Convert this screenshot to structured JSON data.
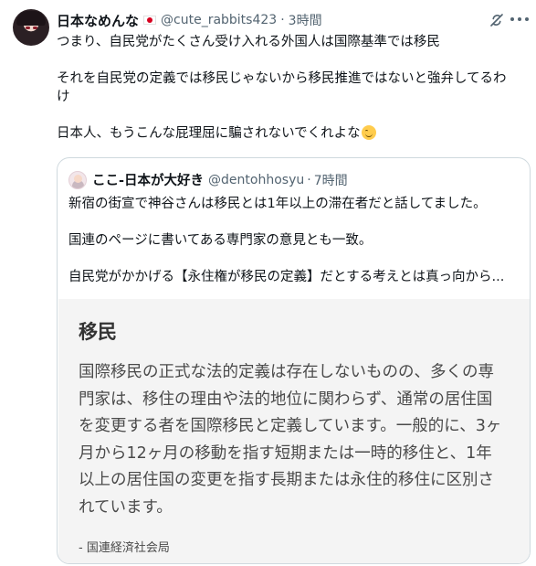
{
  "post": {
    "author_name": "日本なめんな",
    "handle": "@cute_rabbits423",
    "separator": "·",
    "time": "3時間",
    "lines": [
      "つまり、自民党がたくさん受け入れる外国人は国際基準では移民",
      "",
      "それを自民党の定義では移民じゃないから移民推進ではないと強弁してるわ",
      "け",
      "",
      "日本人、もうこんな屁理屈に騙されないでくれよな"
    ],
    "flag_icon": "japan-flag-icon",
    "end_emoji_icon": "winking-face-icon"
  },
  "quote": {
    "author_name": "ここ-日本が大好き",
    "handle": "@dentohhosyu",
    "separator": "·",
    "time": "7時間",
    "lines": [
      "新宿の街宣で神谷さんは移民とは1年以上の滞在者だと話してました。",
      "",
      "国連のページに書いてある専門家の意見とも一致。",
      "",
      "自民党がかかげる【永住権が移民の定義】だとする考えとは真っ向から..."
    ],
    "image": {
      "title": "移民",
      "body_lines": [
        "国際移民の正式な法的定義は存在しないものの、多くの専",
        "門家は、移住の理由や法的地位に関わらず、通常の居住国",
        "を変更する者を国際移民と定義しています。一般的に、3ヶ",
        "月から12ヶ月の移動を指す短期または一時的移住と、1年",
        "以上の居住国の変更を指す長期または永住的移住に区別さ",
        "れています。"
      ],
      "source": "- 国連経済社会局"
    }
  },
  "icons": {
    "grok": "grok-icon",
    "more": "more-options-icon"
  }
}
